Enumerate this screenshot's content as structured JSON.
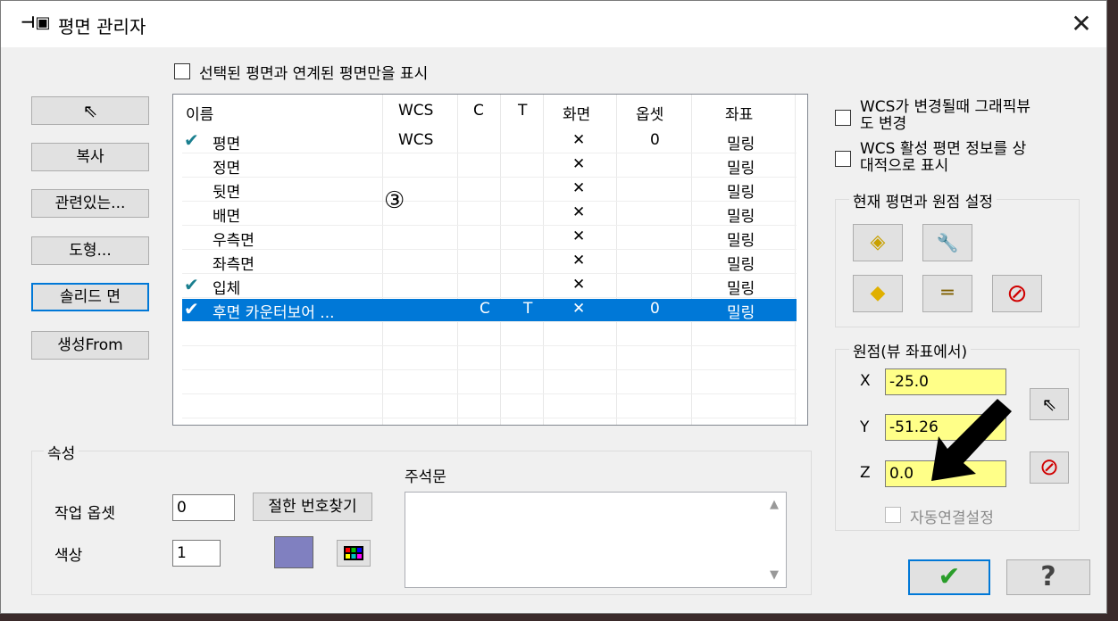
{
  "window": {
    "title": "평면 관리자",
    "icon": "plane-pin-icon",
    "close": "✕"
  },
  "filter_checkbox": {
    "label": "선택된 평면과 연계된 평면만을 표시",
    "checked": false
  },
  "left_buttons": [
    {
      "label": "⇖",
      "name": "select-button"
    },
    {
      "label": "복사",
      "name": "copy-button"
    },
    {
      "label": "관련있는...",
      "name": "related-button"
    },
    {
      "label": "도형...",
      "name": "geometry-button"
    },
    {
      "label": "솔리드 면",
      "name": "solid-face-button"
    },
    {
      "label": "생성From",
      "name": "create-from-button"
    }
  ],
  "table": {
    "headers": [
      "이름",
      "WCS",
      "C",
      "T",
      "화면",
      "옵셋",
      "좌표"
    ],
    "rows": [
      {
        "check": "✔",
        "name": "평면",
        "wcs": "WCS",
        "c": "",
        "t": "",
        "view": "✕",
        "offset": "0",
        "coord": "밀링",
        "selected": false
      },
      {
        "check": "",
        "name": "정면",
        "wcs": "",
        "c": "",
        "t": "",
        "view": "✕",
        "offset": "",
        "coord": "밀링",
        "selected": false
      },
      {
        "check": "",
        "name": "뒷면",
        "wcs": "",
        "c": "",
        "t": "",
        "view": "✕",
        "offset": "",
        "coord": "밀링",
        "selected": false
      },
      {
        "check": "",
        "name": "배면",
        "wcs": "",
        "c": "",
        "t": "",
        "view": "✕",
        "offset": "",
        "coord": "밀링",
        "selected": false
      },
      {
        "check": "",
        "name": "우측면",
        "wcs": "",
        "c": "",
        "t": "",
        "view": "✕",
        "offset": "",
        "coord": "밀링",
        "selected": false
      },
      {
        "check": "",
        "name": "좌측면",
        "wcs": "",
        "c": "",
        "t": "",
        "view": "✕",
        "offset": "",
        "coord": "밀링",
        "selected": false
      },
      {
        "check": "✔",
        "name": "입체",
        "wcs": "",
        "c": "",
        "t": "",
        "view": "✕",
        "offset": "",
        "coord": "밀링",
        "selected": false
      },
      {
        "check": "✔",
        "name": "후면 카운터보어 ...",
        "wcs": "",
        "c": "C",
        "t": "T",
        "view": "✕",
        "offset": "0",
        "coord": "밀링",
        "selected": true
      }
    ],
    "annotation": "③"
  },
  "right_options": [
    {
      "line1": "WCS가 변경될때 그래픽뷰",
      "line2": "도 변경",
      "checked": false
    },
    {
      "line1": "WCS 활성 평면 정보를 상",
      "line2": "대적으로 표시",
      "checked": false
    }
  ],
  "set_group": {
    "title": "현재 평면과 원점 설정",
    "buttons": [
      {
        "icon": "plane-set-icon",
        "glyph": "◈"
      },
      {
        "icon": "tool-plane-icon",
        "glyph": "🔧"
      },
      {
        "icon": "both-plane-icon",
        "glyph": "◆"
      },
      {
        "icon": "equal-icon",
        "glyph": "═"
      },
      {
        "icon": "clear-icon",
        "glyph": "⊘"
      }
    ]
  },
  "origin_group": {
    "title": "원점(뷰 좌표에서)",
    "x_label": "X",
    "x_value": "-25.0",
    "y_label": "Y",
    "y_value": "-51.26",
    "z_label": "Z",
    "z_value": "0.0",
    "auto_label": "자동연결설정",
    "pick_glyph": "⇖",
    "clear_glyph": "⊘"
  },
  "properties": {
    "title": "속성",
    "offset_label": "작업 옵셋",
    "offset_value": "0",
    "find_button": "절한 번호찾기",
    "color_label": "색상",
    "color_value": "1",
    "swatch_color": "#8080c0",
    "comment_label": "주석문"
  },
  "footer": {
    "ok_glyph": "✔",
    "help_glyph": "?"
  },
  "colors": {
    "accent": "#0078d7",
    "check": "#1a7f8f",
    "yellow": "#ffff88",
    "ok_green": "#2a9d2a",
    "clear_red": "#d00000"
  }
}
